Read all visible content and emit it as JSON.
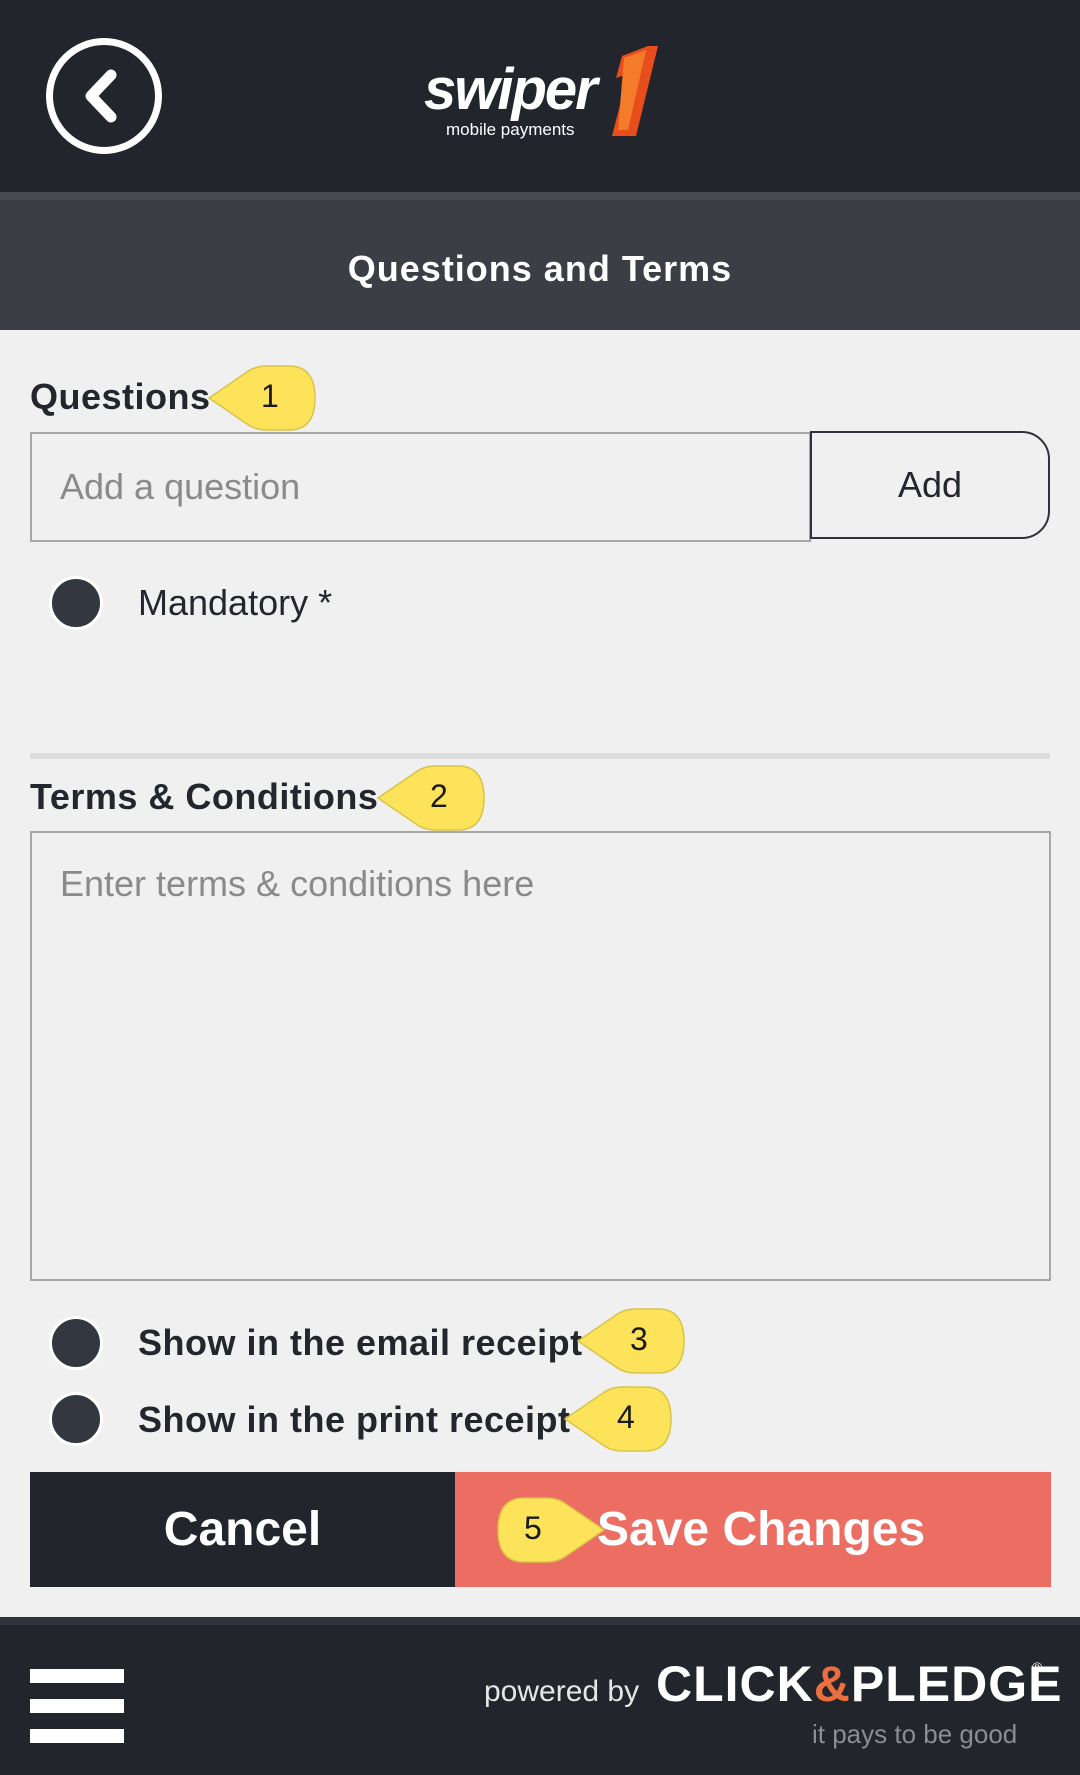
{
  "header": {
    "logo_word": "swiper",
    "logo_sub": "mobile payments",
    "title": "Questions and Terms"
  },
  "questions": {
    "label": "Questions",
    "placeholder": "Add a question",
    "add_label": "Add",
    "mandatory_label": "Mandatory *"
  },
  "terms": {
    "label": "Terms & Conditions",
    "placeholder": "Enter terms & conditions here",
    "email_receipt_label": "Show in the email receipt",
    "print_receipt_label": "Show in the print receipt"
  },
  "actions": {
    "cancel_label": "Cancel",
    "save_label": "Save Changes"
  },
  "callouts": [
    "1",
    "2",
    "3",
    "4",
    "5"
  ],
  "footer": {
    "powered_by": "powered by",
    "brand_left": "CLICK",
    "brand_amp": "&",
    "brand_right": "PLEDGE",
    "brand_reg": "®",
    "tagline": "it pays to be good"
  },
  "icons": {
    "back": "chevron-left-circle-icon",
    "menu": "hamburger-menu-icon"
  },
  "colors": {
    "header_bg": "#22252c",
    "titlebar_bg": "#3b3e45",
    "accent": "#ec6e63",
    "callout": "#fce35a",
    "brand_logo": "#e84e1b"
  }
}
